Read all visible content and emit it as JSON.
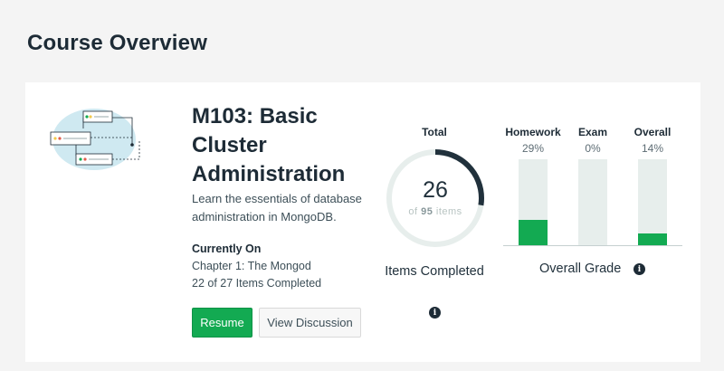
{
  "page": {
    "title": "Course Overview"
  },
  "course": {
    "title": "M103: Basic Cluster Administration",
    "description": "Learn the essentials of database administration in MongoDB."
  },
  "current": {
    "heading": "Currently On",
    "chapter": "Chapter 1: The Mongod",
    "progress": "22 of 27 Items Completed"
  },
  "buttons": {
    "resume": "Resume",
    "discussion": "View Discussion"
  },
  "total": {
    "label": "Total",
    "count": "26",
    "of_prefix": "of",
    "of_value": "95",
    "of_suffix": "items",
    "caption": "Items Completed",
    "fraction": 0.274
  },
  "grades": {
    "caption": "Overall Grade",
    "items": [
      {
        "label": "Homework",
        "pct_text": "29%",
        "value": 29
      },
      {
        "label": "Exam",
        "pct_text": "0%",
        "value": 0
      },
      {
        "label": "Overall",
        "pct_text": "14%",
        "value": 14
      }
    ]
  },
  "colors": {
    "accent": "#13aa52",
    "ring_track": "#e7eeec",
    "ring_fill": "#21313c"
  },
  "icons": {
    "info": "info-icon",
    "illustration": "cluster-diagram-illustration"
  }
}
